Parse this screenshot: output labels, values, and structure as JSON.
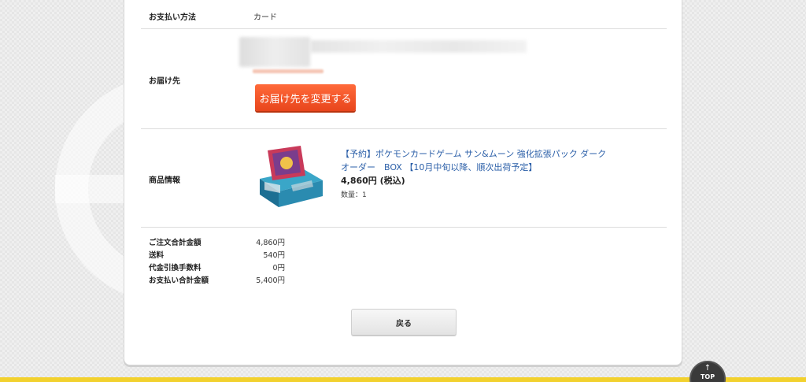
{
  "order": {
    "payment": {
      "label": "お支払い方法",
      "value": "カード"
    },
    "delivery": {
      "label": "お届け先",
      "change_button": "お届け先を変更する"
    },
    "product": {
      "label": "商品情報",
      "title_line1": "【予約】ポケモンカードゲーム サン&ムーン 強化拡張パック ダーク",
      "title_line2": "オーダー　BOX 【10月中旬以降、順次出荷予定】",
      "price": "4,860円 (税込)",
      "quantity": "数量：1"
    },
    "summary": [
      {
        "label": "ご注文合計金額",
        "value": "4,860円"
      },
      {
        "label": "送料",
        "value": "540円"
      },
      {
        "label": "代金引換手数料",
        "value": "0円"
      },
      {
        "label": "お支払い合計金額",
        "value": "5,400円"
      }
    ],
    "back_button": "戻る"
  },
  "page_top": {
    "label": "TOP",
    "icon": "arrow-up-icon"
  }
}
